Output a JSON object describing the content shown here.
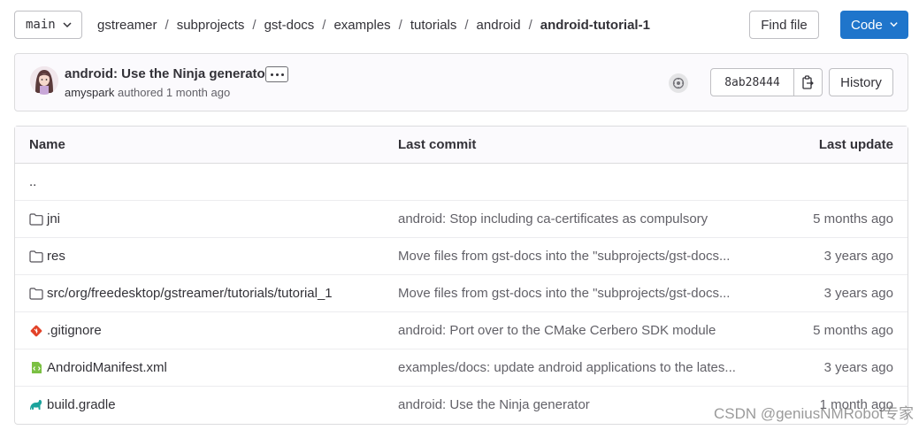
{
  "topbar": {
    "branch": "main",
    "breadcrumb": [
      "gstreamer",
      "subprojects",
      "gst-docs",
      "examples",
      "tutorials",
      "android",
      "android-tutorial-1"
    ],
    "find_file_label": "Find file",
    "code_label": "Code"
  },
  "commit": {
    "title": "android: Use the Ninja generator",
    "author": "amyspark",
    "meta_suffix": "authored 1 month ago",
    "sha": "8ab28444",
    "history_label": "History"
  },
  "table": {
    "headers": {
      "name": "Name",
      "last_commit": "Last commit",
      "last_update": "Last update"
    },
    "updir": "..",
    "rows": [
      {
        "icon": "folder-icon",
        "name": "jni",
        "commit": "android: Stop including ca-certificates as compulsory",
        "updated": "5 months ago"
      },
      {
        "icon": "folder-icon",
        "name": "res",
        "commit": "Move files from gst-docs into the \"subprojects/gst-docs...",
        "updated": "3 years ago"
      },
      {
        "icon": "folder-icon",
        "name": "src/org/freedesktop/gstreamer/tutorials/tutorial_1",
        "commit": "Move files from gst-docs into the \"subprojects/gst-docs...",
        "updated": "3 years ago"
      },
      {
        "icon": "git-icon",
        "name": ".gitignore",
        "commit": "android: Port over to the CMake Cerbero SDK module",
        "updated": "5 months ago"
      },
      {
        "icon": "xml-file-icon",
        "name": "AndroidManifest.xml",
        "commit": "examples/docs: update android applications to the lates...",
        "updated": "3 years ago"
      },
      {
        "icon": "gradle-icon",
        "name": "build.gradle",
        "commit": "android: Use the Ninja generator",
        "updated": "1 month ago"
      }
    ]
  },
  "watermark": "CSDN @geniusNMRobot专家",
  "colors": {
    "primary": "#1f75cb",
    "git": "#e24329",
    "xml": "#7bc043",
    "gradle": "#1ba39c"
  }
}
